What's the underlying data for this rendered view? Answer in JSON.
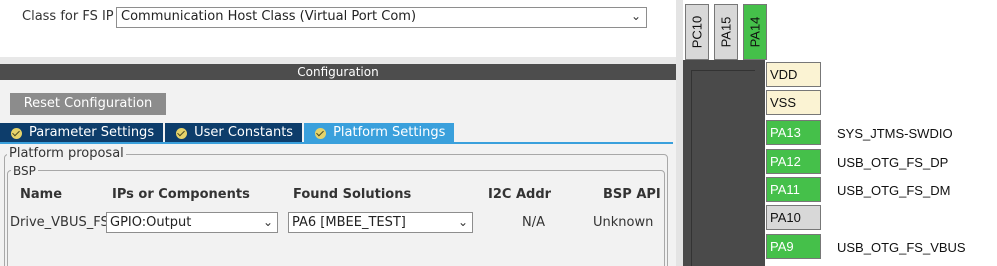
{
  "fs_ip": {
    "label": "Class for FS IP",
    "selected": "Communication Host Class (Virtual Port Com)"
  },
  "configuration": {
    "title": "Configuration",
    "reset_label": "Reset Configuration",
    "tabs": [
      {
        "label": "Parameter Settings",
        "active": false
      },
      {
        "label": "User Constants",
        "active": false
      },
      {
        "label": "Platform Settings",
        "active": true
      }
    ],
    "platform_proposal": {
      "legend": "Platform proposal",
      "bsp_legend": "BSP",
      "columns": [
        "Name",
        "IPs or Components",
        "Found Solutions",
        "I2C Addr",
        "BSP API"
      ],
      "rows": [
        {
          "name": "Drive_VBUS_FS",
          "ip": "GPIO:Output",
          "solution": "PA6 [MBEE_TEST]",
          "i2c": "N/A",
          "api": "Unknown"
        }
      ]
    }
  },
  "chip": {
    "top_pins": [
      {
        "label": "PC10",
        "color": "#d8d8d8"
      },
      {
        "label": "PA15",
        "color": "#d8d8d8"
      },
      {
        "label": "PA14",
        "color": "#45c04a"
      }
    ],
    "side_pins": [
      {
        "label": "VDD",
        "color": "#fbf3d3",
        "signal": ""
      },
      {
        "label": "VSS",
        "color": "#fbf3d3",
        "signal": ""
      },
      {
        "label": "PA13",
        "color": "#45c04a",
        "signal": "SYS_JTMS-SWDIO"
      },
      {
        "label": "PA12",
        "color": "#45c04a",
        "signal": "USB_OTG_FS_DP"
      },
      {
        "label": "PA11",
        "color": "#45c04a",
        "signal": "USB_OTG_FS_DM"
      },
      {
        "label": "PA10",
        "color": "#d8d8d8",
        "signal": ""
      },
      {
        "label": "PA9",
        "color": "#45c04a",
        "signal": "USB_OTG_FS_VBUS"
      }
    ]
  },
  "icons": {
    "tab_status": "check-circle-icon",
    "dropdown": "chevron-down-icon"
  }
}
